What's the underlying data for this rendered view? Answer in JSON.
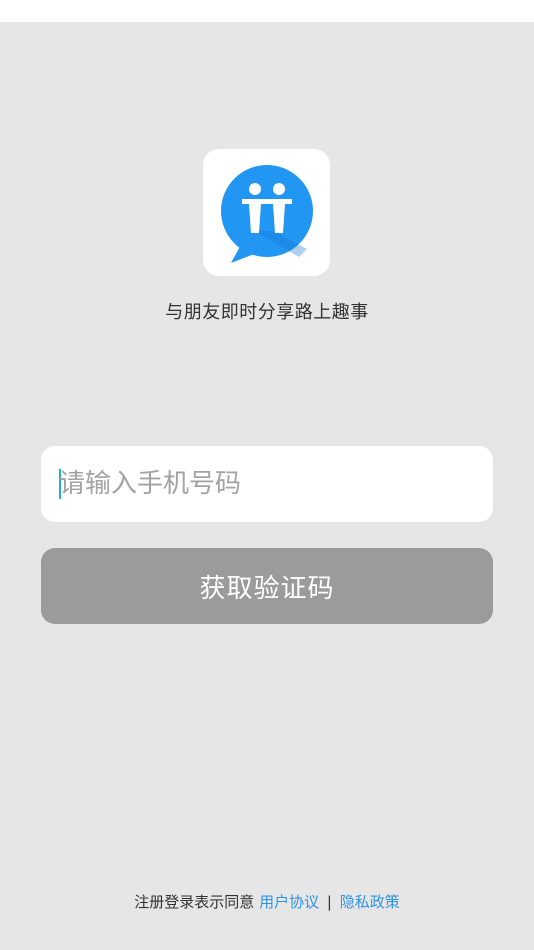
{
  "app": {
    "logo_icon": "friends-chat-bubble-icon",
    "tagline": "与朋友即时分享路上趣事",
    "colors": {
      "background": "#e6e6e6",
      "logo_blue": "#2196f3",
      "link_blue": "#2f93e6",
      "caret": "#21b2c2",
      "button_disabled": "#9b9b9b"
    }
  },
  "login_form": {
    "phone_input": {
      "placeholder": "请输入手机号码",
      "value": ""
    },
    "get_code_button": {
      "label": "获取验证码",
      "enabled": false
    }
  },
  "footer": {
    "agreement_prefix": "注册登录表示同意",
    "user_agreement": "用户协议",
    "separator": "|",
    "privacy_policy": "隐私政策"
  }
}
